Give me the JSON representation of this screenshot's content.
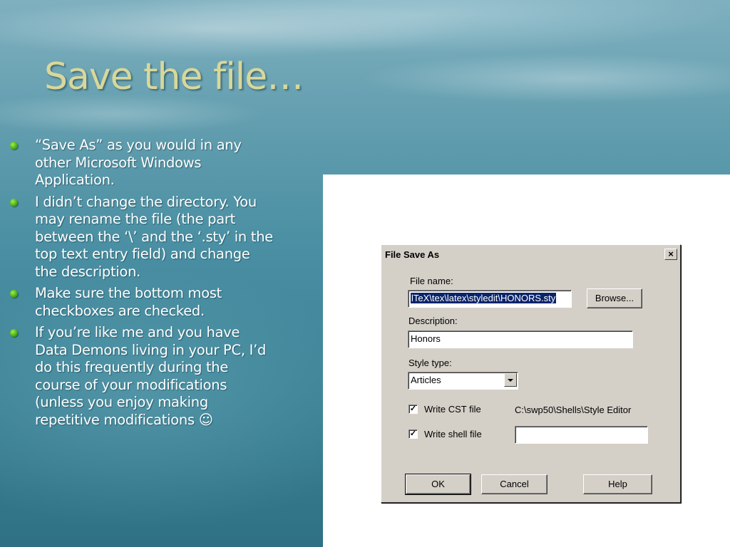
{
  "slide": {
    "title": "Save the file…",
    "bullets": [
      "“Save As” as you would in any other Microsoft Windows Application.",
      "I didn’t change the directory. You may rename the file (the part between the ‘\\’ and the ‘.sty’ in the top text entry field) and change the description.",
      "Make sure the bottom most checkboxes are checked.",
      "If you’re like me and you have Data Demons living in your PC, I’d do this frequently during the course of your modifications (unless you enjoy making repetitive modifications ☺"
    ]
  },
  "dialog": {
    "title": "File Save As",
    "close_glyph": "×",
    "file_name_label": "File name:",
    "file_name_value": "lTeX\\tex\\latex\\styledit\\HONORS.sty",
    "browse_label": "Browse...",
    "description_label": "Description:",
    "description_value": "Honors",
    "style_type_label": "Style type:",
    "style_type_value": "Articles",
    "write_cst_label": "Write CST file",
    "write_cst_checked": true,
    "cst_path": "C:\\swp50\\Shells\\Style Editor",
    "write_shell_label": "Write shell file",
    "write_shell_checked": true,
    "shell_path_value": "",
    "check_glyph": "✓",
    "ok_label": "OK",
    "cancel_label": "Cancel",
    "help_label": "Help"
  },
  "colors": {
    "title": "#d9d79a",
    "bullet": "#5cc21c",
    "dialog_face": "#d4d0c8",
    "selection": "#0a246a"
  }
}
